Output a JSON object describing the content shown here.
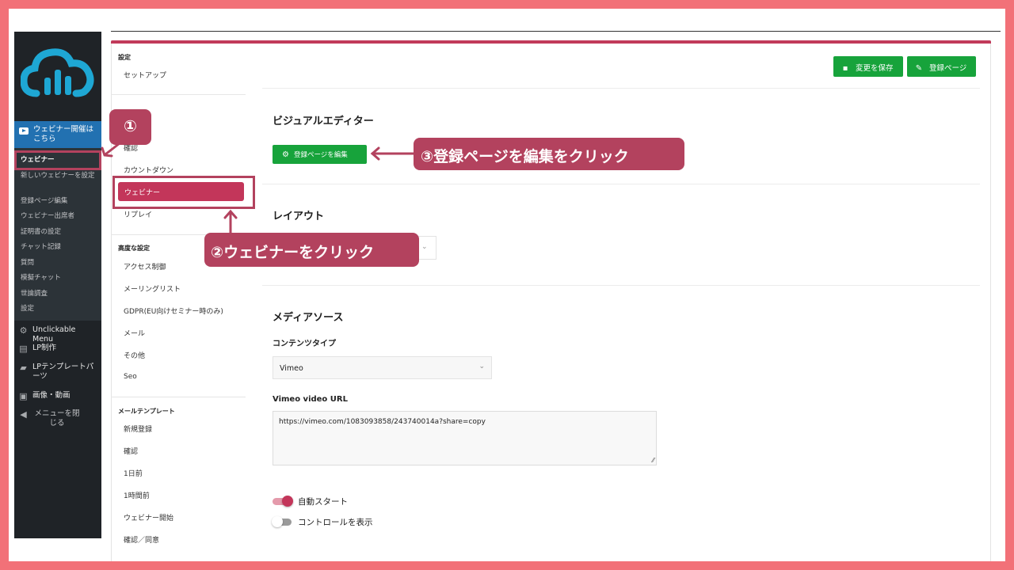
{
  "colors": {
    "accent": "#c3365a",
    "callout": "#b3425e",
    "green": "#17a33b",
    "sidebar": "#1f2327",
    "active_menu": "#2271b1",
    "border": "#f27178"
  },
  "sidebar": {
    "logo_icon": "cloud-logo-icon",
    "active_menu_label": "ウェビナー開催はこちら",
    "submenu": [
      "ウェビナー",
      "新しいウェビナーを設定",
      "登録ページ編集",
      "ウェビナー出席者",
      "証明書の設定",
      "チャット記録",
      "質問",
      "模擬チャット",
      "世論調査",
      "設定"
    ],
    "items": [
      {
        "icon": "gear-icon",
        "label": "Unclickable Menu"
      },
      {
        "icon": "pages-icon",
        "label": "LP制作"
      },
      {
        "icon": "folder-icon",
        "label": "LPテンプレートパーツ"
      },
      {
        "icon": "media-icon",
        "label": "画像・動画"
      },
      {
        "icon": "collapse-icon",
        "label": "メニューを閉じる"
      }
    ]
  },
  "settings_nav": {
    "group1_head": "設定",
    "setup": "セットアップ",
    "confirm": "確認",
    "countdown": "カウントダウン",
    "webinar": "ウェビナー",
    "replay": "リプレイ",
    "group2_head": "高度な設定",
    "advanced": [
      "アクセス制御",
      "メーリングリスト",
      "GDPR(EU向けセミナー時のみ)",
      "メール",
      "その他",
      "Seo"
    ],
    "group3_head": "メールテンプレート",
    "mail_templates": [
      "新規登録",
      "確認",
      "1日前",
      "1時間前",
      "ウェビナー開始",
      "確認／同意"
    ]
  },
  "toolbar": {
    "save_label": "変更を保存",
    "register_label": "登録ページ"
  },
  "main": {
    "visual_editor_title": "ビジュアルエディター",
    "edit_register_button": "登録ページを編集",
    "layout_title": "レイアウト",
    "media_title": "メディアソース",
    "content_type_label": "コンテンツタイプ",
    "content_type_value": "Vimeo",
    "vimeo_url_label": "Vimeo video URL",
    "vimeo_url_value": "https://vimeo.com/1083093858/243740014a?share=copy",
    "autostart_label": "自動スタート",
    "autostart_on": true,
    "controls_label": "コントロールを表示",
    "controls_on": false
  },
  "callouts": {
    "step1": "①",
    "step2": "②ウェビナーをクリック",
    "step3": "③登録ページを編集をクリック"
  }
}
